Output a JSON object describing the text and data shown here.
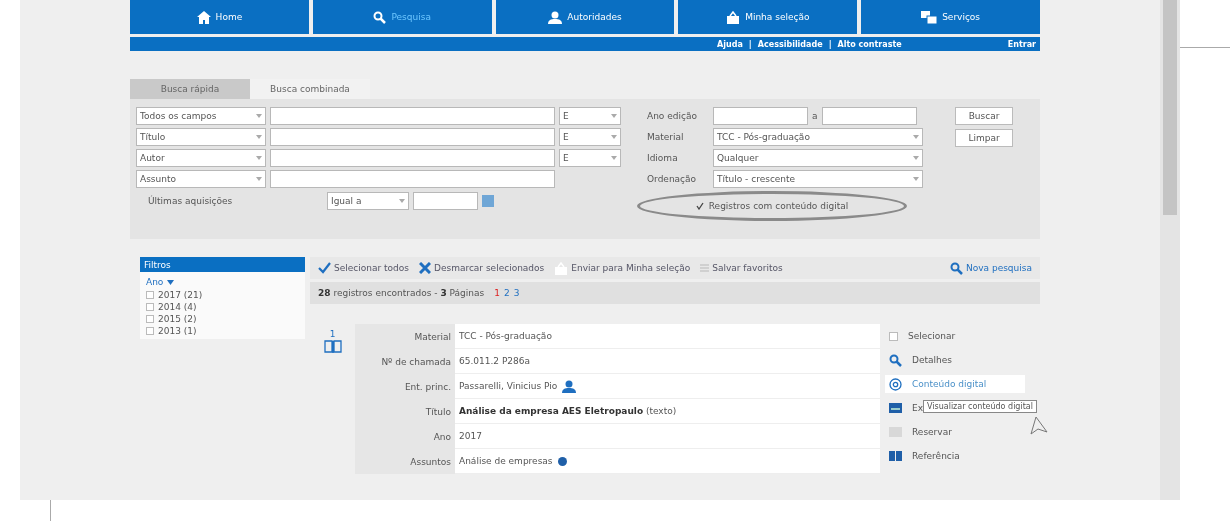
{
  "nav": {
    "tabs": [
      {
        "label": "Home",
        "selected": false
      },
      {
        "label": "Pesquisa",
        "selected": true
      },
      {
        "label": "Autoridades",
        "selected": false
      },
      {
        "label": "Minha seleção",
        "selected": false
      },
      {
        "label": "Serviços",
        "selected": false
      }
    ]
  },
  "top_bar": {
    "links": [
      "Ajuda",
      "Acessibilidade",
      "Alto contraste"
    ],
    "separator": "|",
    "login": "Entrar"
  },
  "search_tabs": [
    {
      "label": "Busca rápida",
      "selected": true
    },
    {
      "label": "Busca combinada",
      "selected": false
    }
  ],
  "search_rows": [
    {
      "field": "Todos os campos",
      "operator": "E"
    },
    {
      "field": "Título",
      "operator": "E"
    },
    {
      "field": "Autor",
      "operator": "E"
    },
    {
      "field": "Assunto"
    }
  ],
  "acquisitions": {
    "label": "Últimas aquisições",
    "comparator": "Igual a"
  },
  "filters_right": {
    "year_label": "Ano edição",
    "year_between": "a",
    "rows": [
      {
        "label": "Material",
        "value": "TCC - Pós-graduação"
      },
      {
        "label": "Idioma",
        "value": "Qualquer"
      },
      {
        "label": "Ordenação",
        "value": "Título - crescente"
      }
    ],
    "digital_only": {
      "label": "Registros com conteúdo digital",
      "checked": true
    }
  },
  "buttons": [
    "Buscar",
    "Limpar"
  ],
  "filters_panel": {
    "title": "Filtros",
    "group": "Ano",
    "items": [
      {
        "label": "2017 (21)",
        "checked": false
      },
      {
        "label": "2014 (4)",
        "checked": false
      },
      {
        "label": "2015 (2)",
        "checked": false
      },
      {
        "label": "2013 (1)",
        "checked": false
      }
    ]
  },
  "toolbar": {
    "actions": [
      "Selecionar todos",
      "Desmarcar selecionados",
      "Enviar para Minha seleção",
      "Salvar favoritos"
    ],
    "new_search": "Nova pesquisa"
  },
  "summary": {
    "text": "**28** registros encontrados - **3** Páginas",
    "pages": [
      {
        "label": "1",
        "selected": true
      },
      {
        "label": "2",
        "selected": false
      },
      {
        "label": "3",
        "selected": false
      }
    ]
  },
  "record": {
    "number": "1",
    "fields": [
      {
        "label": "Material",
        "value": "TCC - Pós-graduação",
        "kind": "plain"
      },
      {
        "label": "Nº de chamada",
        "value": "65.011.2 P286a",
        "kind": "plain"
      },
      {
        "label": "Ent. princ.",
        "value": "Passarelli, Vinicius Pio",
        "kind": "person"
      },
      {
        "label": "Título",
        "value": "**Análise da empresa AES Eletropaulo** (texto)",
        "kind": "plain"
      },
      {
        "label": "Ano",
        "value": "2017",
        "kind": "plain"
      },
      {
        "label": "Assuntos",
        "value": "Análise de empresas",
        "kind": "info"
      }
    ],
    "actions": [
      {
        "label": "Selecionar",
        "selected": false
      },
      {
        "label": "Detalhes",
        "selected": false
      },
      {
        "label": "Conteúdo digital",
        "selected": true
      },
      {
        "label": "Ex",
        "selected": false
      },
      {
        "label": "Reservar",
        "selected": false
      },
      {
        "label": "Referência",
        "selected": false
      }
    ],
    "tooltip": "Visualizar conteúdo digital"
  }
}
